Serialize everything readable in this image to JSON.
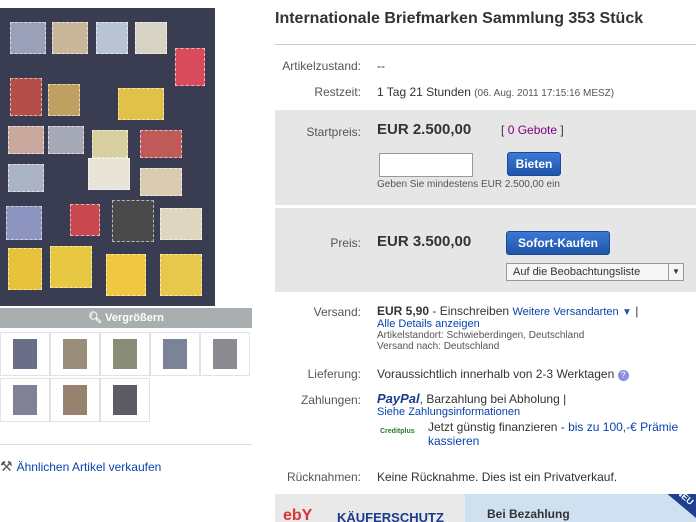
{
  "title": "Internationale Briefmarken Sammlung 353 Stück",
  "gallery": {
    "enlarge_label": "Vergrößern",
    "sell_similar": "Ähnlichen Artikel verkaufen"
  },
  "condition": {
    "label": "Artikelzustand:",
    "value": "--"
  },
  "remaining": {
    "label": "Restzeit:",
    "value": "1 Tag 21 Stunden",
    "date": "(06. Aug. 2011 17:15:16 MESZ)"
  },
  "bid": {
    "label": "Startpreis:",
    "price": "EUR 2.500,00",
    "bids_open": "[",
    "bids_link": "0 Gebote",
    "bids_close": "]",
    "input_value": "",
    "button": "Bieten",
    "hint": "Geben Sie mindestens EUR 2.500,00 ein"
  },
  "buy_now": {
    "label": "Preis:",
    "price": "EUR 3.500,00",
    "button": "Sofort-Kaufen",
    "watch_label": "Auf die Beobachtungsliste"
  },
  "shipping": {
    "label": "Versand:",
    "price": "EUR 5,90",
    "method": "- Einschreiben",
    "more_link": "Weitere Versandarten",
    "details_link": "Alle Details anzeigen",
    "location": "Artikelstandort: Schwieberdingen, Deutschland",
    "ships_to": "Versand nach: Deutschland"
  },
  "delivery": {
    "label": "Lieferung:",
    "value": "Voraussichtlich innerhalb von 2-3 Werktagen"
  },
  "payment": {
    "label": "Zahlungen:",
    "paypal_logo": "PayPal",
    "methods": ", Barzahlung bei Abholung |",
    "info_link": "Siehe Zahlungsinformationen",
    "finance_logo": "Creditplus",
    "finance_text": "Jetzt günstig finanzieren -",
    "finance_link": "bis zu 100,-€ Prämie kassieren"
  },
  "returns": {
    "label": "Rücknahmen:",
    "value": "Keine Rücknahme. Dies ist ein Privatverkauf."
  },
  "banner": {
    "logo": "ebY",
    "headline": "KÄUFERSCHUTZ",
    "side": "Bei Bezahlung",
    "ribbon": "NEU"
  },
  "colors": {
    "link": "#0645ad",
    "purple": "#800080",
    "button": "#1f54a8"
  }
}
